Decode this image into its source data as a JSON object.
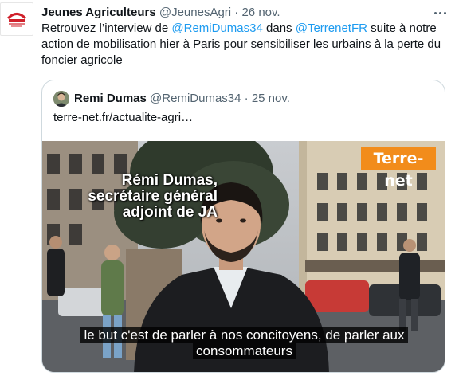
{
  "tweet": {
    "avatar_logo_text": "Jeunes Agriculteurs",
    "author_name": "Jeunes Agriculteurs",
    "author_handle": "@JeunesAgri",
    "separator": "·",
    "time": "26 nov.",
    "text_part1": "Retrouvez l’interview de ",
    "mention1": "@RemiDumas34",
    "text_part2": " dans ",
    "mention2": "@TerrenetFR",
    "text_part3": " suite à notre action de mobilisation hier à Paris pour sensibiliser les urbains à la perte du foncier agricole",
    "more_icon": "more-horizontal-icon"
  },
  "quoted_tweet": {
    "author_name": "Remi Dumas",
    "author_handle": "@RemiDumas34",
    "separator": "·",
    "time": "25 nov.",
    "link_text": "terre-net.fr/actualite-agri…",
    "video": {
      "title_line1": "Rémi Dumas,",
      "title_line2": "secrétaire général",
      "title_line3": "adjoint de JA",
      "brand_logo": "Terre-net",
      "subtitle_line1": "le but c'est de parler à nos concitoyens, de parler aux",
      "subtitle_line2": "consommateurs"
    }
  },
  "colors": {
    "link": "#1d9bf0",
    "secondary_text": "#536471",
    "border": "#cfd9de",
    "brand_orange": "#f28c1b"
  }
}
